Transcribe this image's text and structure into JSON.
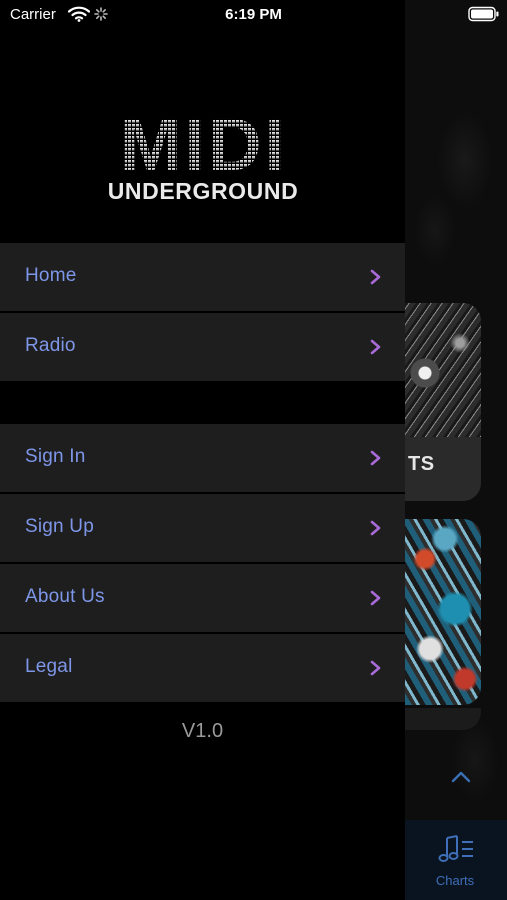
{
  "status_bar": {
    "carrier": "Carrier",
    "time": "6:19 PM",
    "icons": [
      "wifi-icon",
      "activity-icon",
      "battery-icon"
    ]
  },
  "drawer": {
    "logo": {
      "title": "MIDI",
      "subtitle": "UNDERGROUND"
    },
    "menu_primary": [
      {
        "label": "Home"
      },
      {
        "label": "Radio"
      }
    ],
    "menu_secondary": [
      {
        "label": "Sign In"
      },
      {
        "label": "Sign Up"
      },
      {
        "label": "About Us"
      },
      {
        "label": "Legal"
      }
    ],
    "version": "V1.0"
  },
  "background": {
    "card_label": "TS",
    "tab": {
      "label": "Charts",
      "icon": "music-list-icon"
    }
  },
  "colors": {
    "menu_text": "#7E96E8",
    "chevron": "#A86BD8",
    "menu_bg": "#1E1E1E",
    "tab_accent": "#3F6FB8"
  }
}
